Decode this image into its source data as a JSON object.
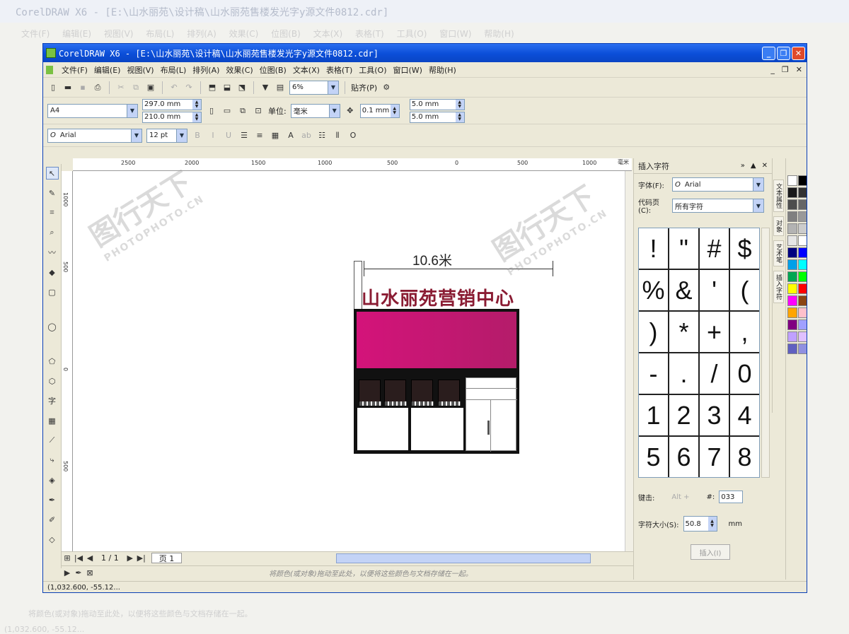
{
  "background": {
    "title": "CorelDRAW X6 - [E:\\山水丽苑\\设计稿\\山水丽苑售楼发光字y源文件0812.cdr]",
    "menu": [
      "文件(F)",
      "编辑(E)",
      "视图(V)",
      "布局(L)",
      "排列(A)",
      "效果(C)",
      "位图(B)",
      "文本(X)",
      "表格(T)",
      "工具(O)",
      "窗口(W)",
      "帮助(H)"
    ],
    "status_coords": "(1,032.600, -55.12...",
    "hint": "将颜色(或对象)拖动至此处，以便将这些颜色与文档存储在一起。"
  },
  "window": {
    "title": "CorelDRAW X6 - [E:\\山水丽苑\\设计稿\\山水丽苑售楼发光字y源文件0812.cdr]",
    "menu": [
      "文件(F)",
      "编辑(E)",
      "视图(V)",
      "布局(L)",
      "排列(A)",
      "效果(C)",
      "位图(B)",
      "文本(X)",
      "表格(T)",
      "工具(O)",
      "窗口(W)",
      "帮助(H)"
    ]
  },
  "toolbar": {
    "zoom": "6%",
    "snap": "贴齐(P)"
  },
  "propbar": {
    "page_size": "A4",
    "width": "297.0 mm",
    "height": "210.0 mm",
    "unit_label": "单位:",
    "unit": "毫米",
    "nudge": "0.1 mm",
    "dup_x": "5.0 mm",
    "dup_y": "5.0 mm"
  },
  "textbar": {
    "font": "Arial",
    "size": "12 pt"
  },
  "rulers": {
    "top_labels": [
      "2500",
      "2000",
      "1500",
      "1000",
      "500",
      "0",
      "500",
      "1000"
    ],
    "top_unit": "毫米",
    "left_labels": [
      "1000",
      "500",
      "0",
      "500"
    ]
  },
  "drawing": {
    "dimension": "10.6米",
    "sign": "山水丽苑营销中心"
  },
  "watermark": {
    "brand": "图行天下",
    "url": "PHOTOPHOTO.CN"
  },
  "page_nav": {
    "pages": "1 / 1",
    "tab": "页 1"
  },
  "hint": "将颜色(或对象)拖动至此处，以便将这些颜色与文档存储在一起。",
  "status_coords": "(1,032.600, -55.12...",
  "docker": {
    "title": "插入字符",
    "font_label": "字体(F):",
    "font": "Arial",
    "codepage_label": "代码页(C):",
    "codepage": "所有字符",
    "chars": [
      "!",
      "\"",
      "#",
      "$",
      "%",
      "&",
      "'",
      "(",
      ")",
      "*",
      "+",
      ",",
      "-",
      ".",
      "/",
      "0",
      "1",
      "2",
      "3",
      "4",
      "5",
      "6",
      "7",
      "8"
    ],
    "keystroke_label": "键击:",
    "keystroke_hint": "Alt +",
    "code_label": "#:",
    "code": "033",
    "size_label": "字符大小(S):",
    "size": "50.8",
    "size_unit": "mm",
    "insert": "插入(I)"
  },
  "side_tabs": [
    "文本属性",
    "对象",
    "艺术笔",
    "插入字符"
  ],
  "palette": [
    "#ffffff",
    "#000000",
    "#1a1a1a",
    "#333333",
    "#4d4d4d",
    "#666666",
    "#808080",
    "#999999",
    "#b3b3b3",
    "#cccccc",
    "#e6e6e6",
    "#ffffff",
    "#000080",
    "#0000ff",
    "#00a0e9",
    "#00ffff",
    "#00a651",
    "#00ff00",
    "#ffff00",
    "#ff0000",
    "#ff00ff",
    "#8b4513",
    "#ffa500",
    "#ffc0cb",
    "#800080",
    "#a0a0ff",
    "#c0a0ff",
    "#e0c0ff",
    "#6060c0",
    "#9090e0"
  ]
}
